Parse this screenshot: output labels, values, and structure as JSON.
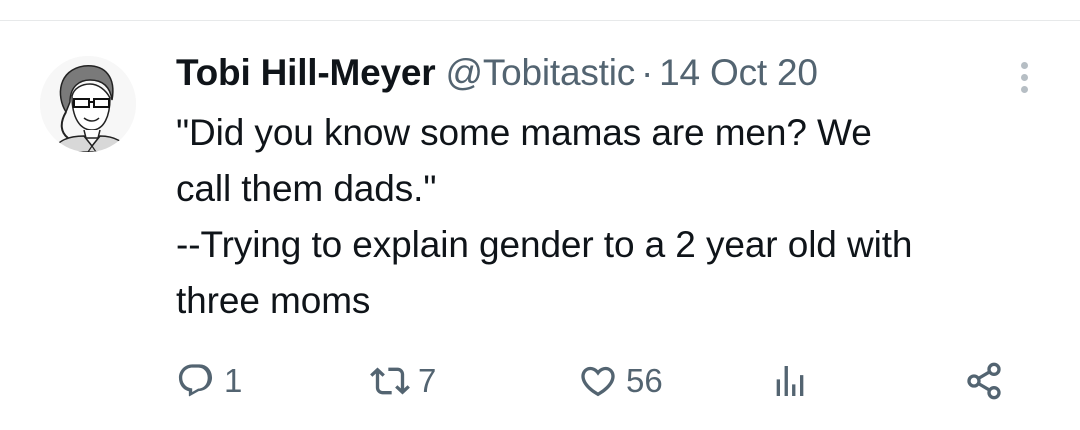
{
  "tweet": {
    "display_name": "Tobi Hill-Meyer",
    "handle": "@Tobitastic",
    "separator": "·",
    "date": "14 Oct 20",
    "body_lines": [
      "\"Did you know some mamas are men? We",
      "call them dads.\"",
      "--Trying to explain gender to a 2 year old with",
      "three moms"
    ]
  },
  "actions": {
    "reply_count": "1",
    "retweet_count": "7",
    "like_count": "56",
    "views_icon": "bar-chart-icon",
    "share_icon": "share-icon"
  },
  "colors": {
    "text_primary": "#0f1419",
    "text_secondary": "#536471",
    "divider": "#e7e9ea"
  }
}
